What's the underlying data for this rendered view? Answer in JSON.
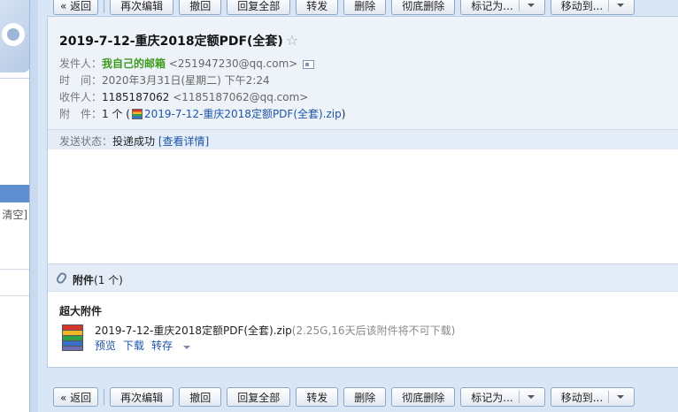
{
  "sidebar": {
    "clear_label": "清空]"
  },
  "toolbar": {
    "back": "« 返回",
    "edit_again": "再次编辑",
    "recall": "撤回",
    "reply_all": "回复全部",
    "forward": "转发",
    "delete": "删除",
    "delete_permanently": "彻底删除",
    "mark_as": "标记为...",
    "move_to": "移动到..."
  },
  "email": {
    "subject": "2019-7-12-重庆2018定额PDF(全套)",
    "star": "☆",
    "from_label": "发件人：",
    "from_name": "我自己的邮箱",
    "from_email": "<251947230@qq.com>",
    "time_label": "时　间：",
    "time_value": "2020年3月31日(星期二) 下午2:24",
    "to_label": "收件人：",
    "to_name": "1185187062",
    "to_email": "<1185187062@qq.com>",
    "attach_label": "附　件：",
    "attach_count": "1 个 (",
    "attach_file": "2019-7-12-重庆2018定额PDF(全套).zip",
    "attach_close": ")",
    "status_label": "发送状态：",
    "status_value": "投递成功",
    "status_detail": "[查看详情]"
  },
  "attachments": {
    "title": "附件",
    "count": "(1 个)",
    "big_label": "超大附件",
    "file_name": "2019-7-12-重庆2018定额PDF(全套).zip",
    "file_info": "(2.25G,16天后该附件将不可下载)",
    "preview": "预览",
    "download": "下载",
    "save_to": "转存"
  },
  "colors": {
    "accent": "#1c55a8",
    "sender_green": "#3d9a1d",
    "toolbar_bg": "#d9e6f5"
  }
}
